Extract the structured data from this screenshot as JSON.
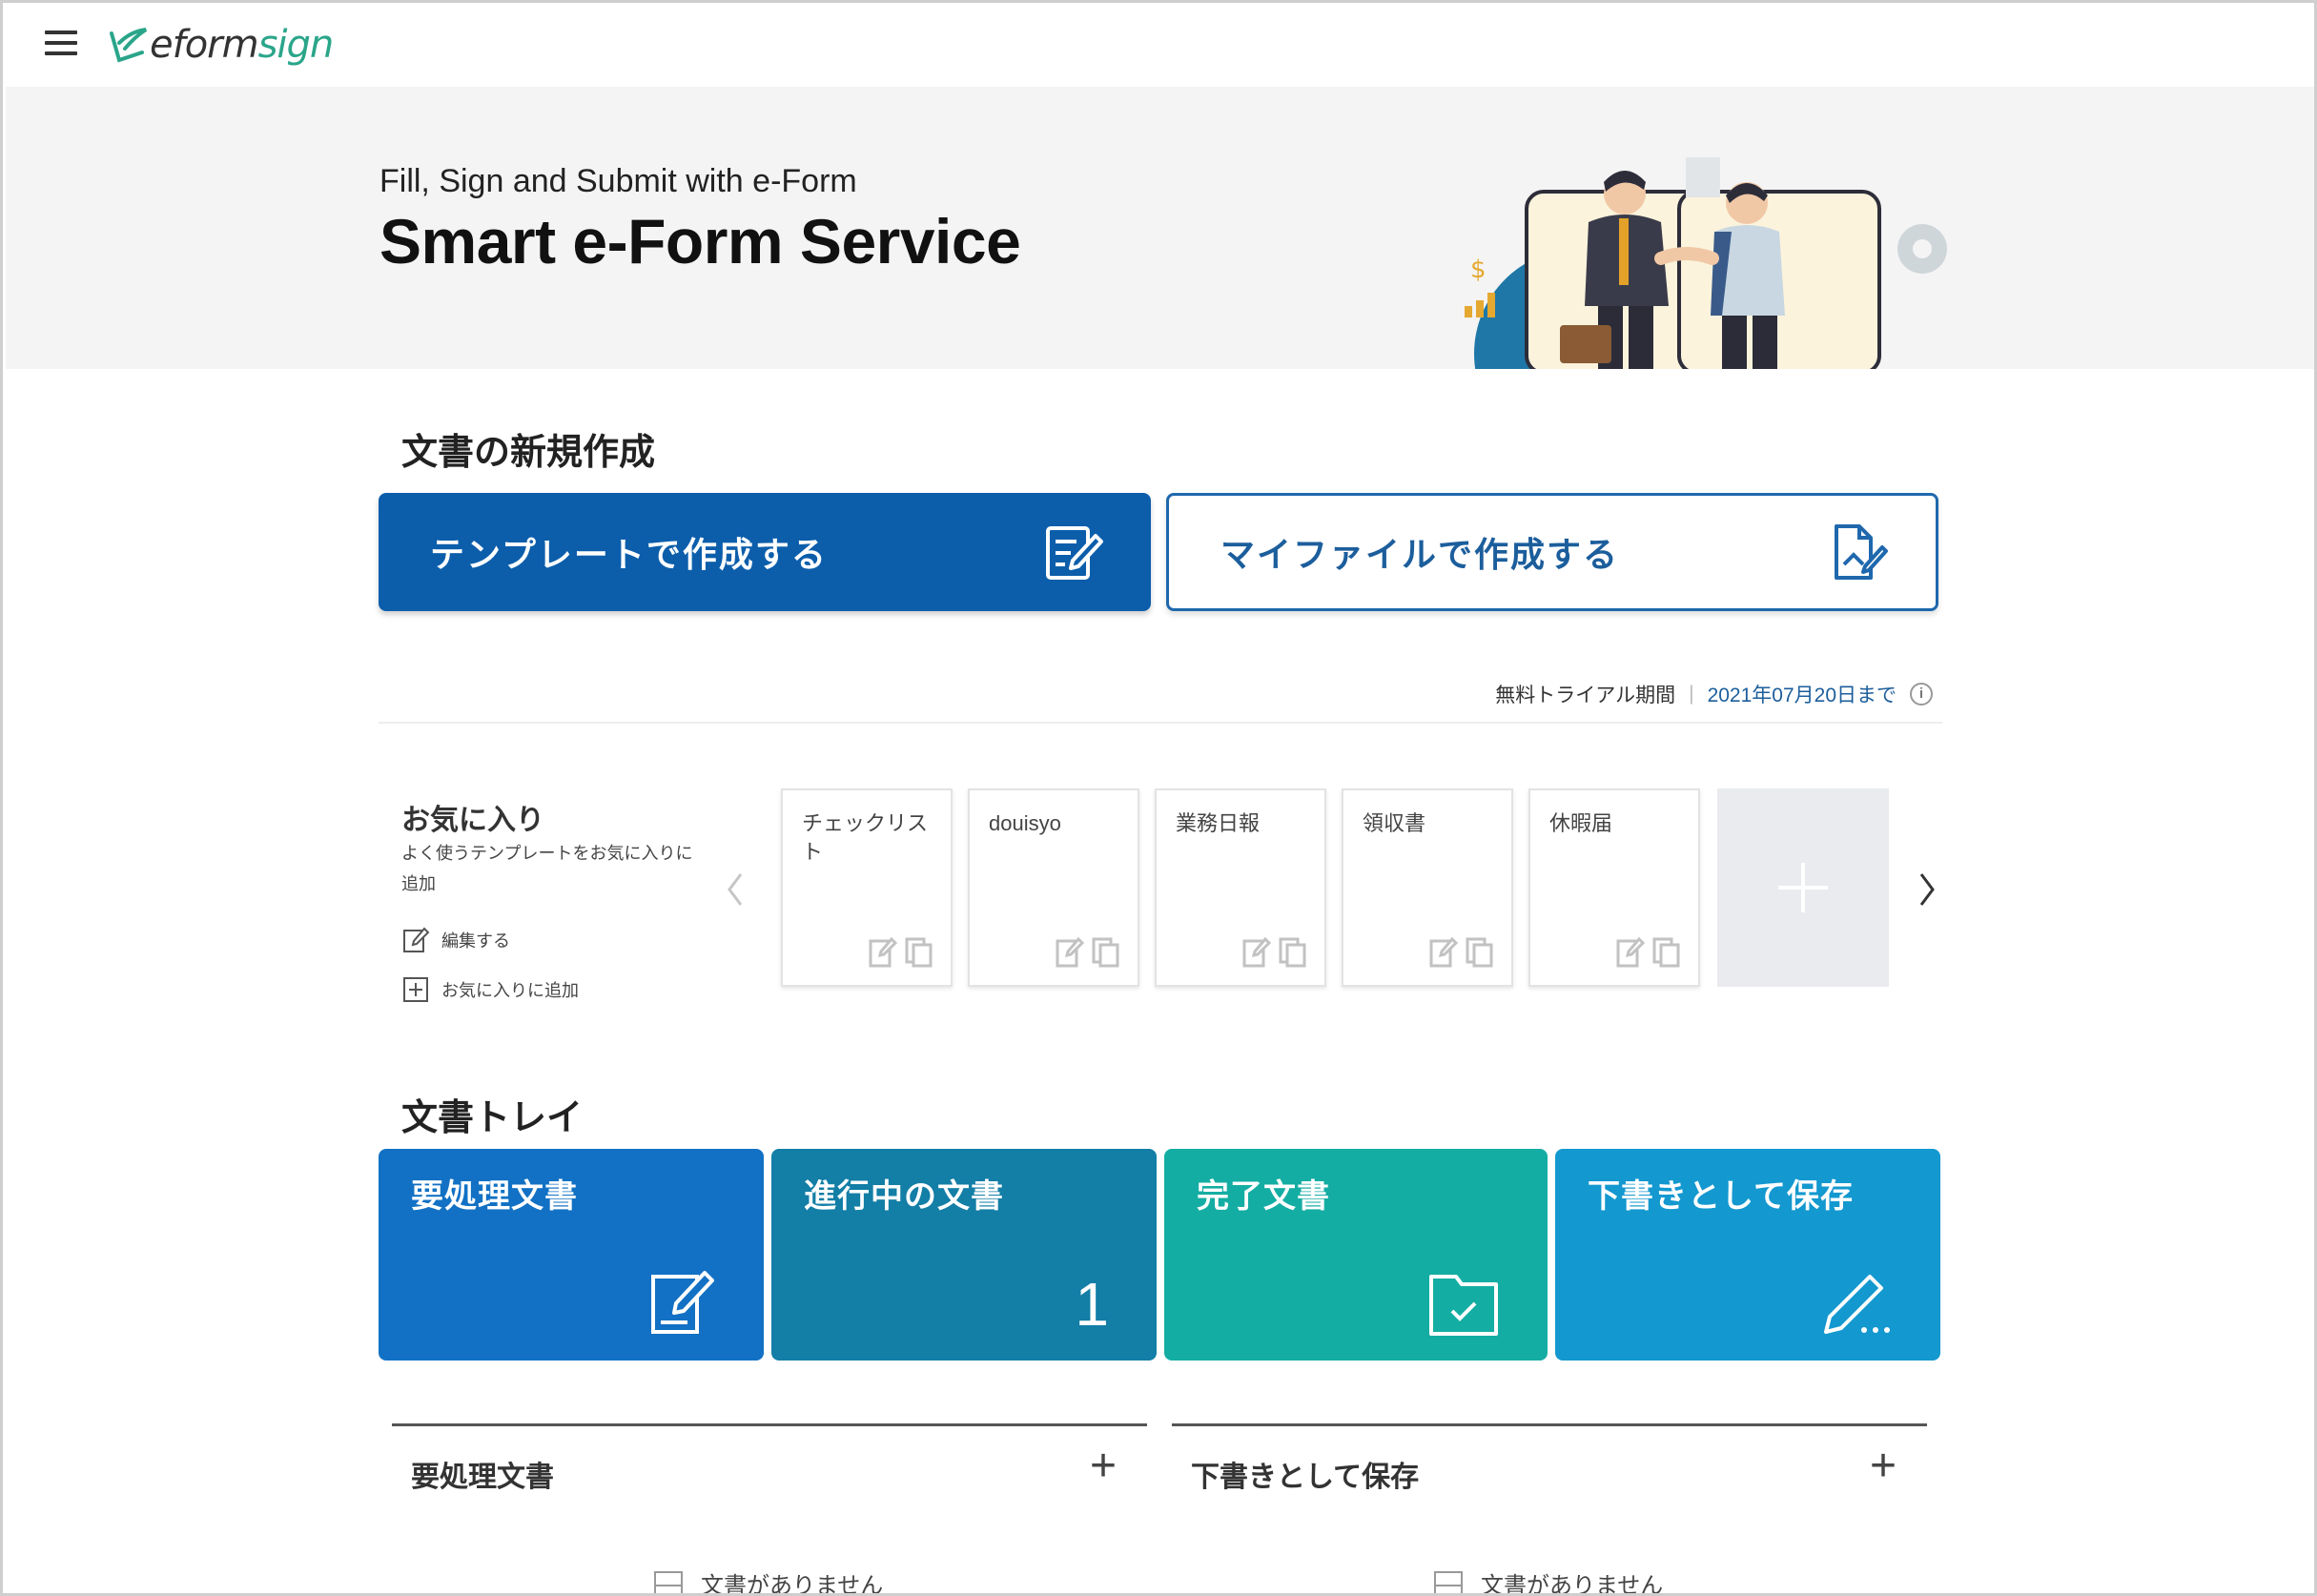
{
  "app": {
    "brand_prefix": "eform",
    "brand_suffix": "sign"
  },
  "hero": {
    "subtitle": "Fill, Sign and Submit with e-Form",
    "title": "Smart e-Form Service"
  },
  "create_section": {
    "title": "文書の新規作成",
    "template_button": "テンプレートで作成する",
    "myfile_button": "マイファイルで作成する"
  },
  "trial": {
    "label": "無料トライアル期間",
    "separator": "|",
    "until": "2021年07月20日まで",
    "info_glyph": "i"
  },
  "favorites": {
    "title": "お気に入り",
    "description": "よく使うテンプレートをお気に入りに追加",
    "edit_label": "編集する",
    "add_label": "お気に入りに追加",
    "cards": [
      {
        "name": "チェックリスト"
      },
      {
        "name": "douisyo"
      },
      {
        "name": "業務日報"
      },
      {
        "name": "領収書"
      },
      {
        "name": "休暇届"
      }
    ]
  },
  "tray": {
    "title": "文書トレイ",
    "tiles": [
      {
        "label": "要処理文書",
        "icon": "edit-document-icon",
        "color": "#1271c4"
      },
      {
        "label": "進行中の文書",
        "count": "1",
        "color": "#137ea6"
      },
      {
        "label": "完了文書",
        "icon": "folder-check-icon",
        "color": "#14ada3"
      },
      {
        "label": "下書きとして保存",
        "icon": "pencil-draft-icon",
        "color": "#1398cf"
      }
    ]
  },
  "lists": {
    "todo": {
      "title": "要処理文書",
      "plus": "+",
      "empty": "文書がありません"
    },
    "drafts": {
      "title": "下書きとして保存",
      "plus": "+",
      "empty": "文書がありません"
    }
  }
}
